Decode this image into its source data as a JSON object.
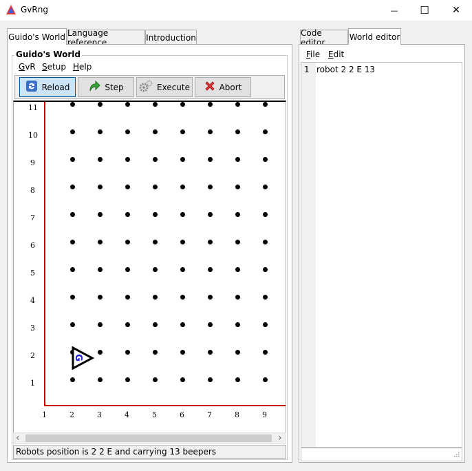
{
  "window": {
    "title": "GvRng",
    "minimize_glyph": "—",
    "maximize_glyph": "☐",
    "close_glyph": "✕"
  },
  "left_tabs": [
    {
      "label": "Guido's World",
      "active": true
    },
    {
      "label": "Language reference",
      "active": false
    },
    {
      "label": "Introduction",
      "active": false
    }
  ],
  "right_tabs": [
    {
      "label": "Code editor",
      "active": false
    },
    {
      "label": "World editor",
      "active": true
    }
  ],
  "world_group": {
    "title": "Guido's World"
  },
  "world_menu": [
    {
      "prefix": "G",
      "rest": "vR"
    },
    {
      "prefix": "S",
      "rest": "etup"
    },
    {
      "prefix": "H",
      "rest": "elp"
    }
  ],
  "toolbar": {
    "reload_label": "Reload",
    "step_label": "Step",
    "execute_label": "Execute",
    "abort_label": "Abort"
  },
  "world": {
    "y_labels": [
      "1",
      "2",
      "3",
      "4",
      "5",
      "6",
      "7",
      "8",
      "9",
      "10",
      "11"
    ],
    "x_labels": [
      "1",
      "2",
      "3",
      "4",
      "5",
      "6",
      "7",
      "8",
      "9"
    ],
    "robot": {
      "x": 2,
      "y": 2,
      "dir": "E",
      "letter": "G"
    },
    "wall_color": "#d00000"
  },
  "status": {
    "text": "Robots position is 2 2 E and carrying 13 beepers"
  },
  "editor_menu": [
    {
      "prefix": "F",
      "rest": "ile"
    },
    {
      "prefix": "E",
      "rest": "dit"
    }
  ],
  "editor": {
    "lines": [
      {
        "num": "1",
        "text": "robot 2 2 E 13"
      }
    ]
  },
  "scroll": {
    "left_arrow": "‹",
    "right_arrow": "›"
  }
}
